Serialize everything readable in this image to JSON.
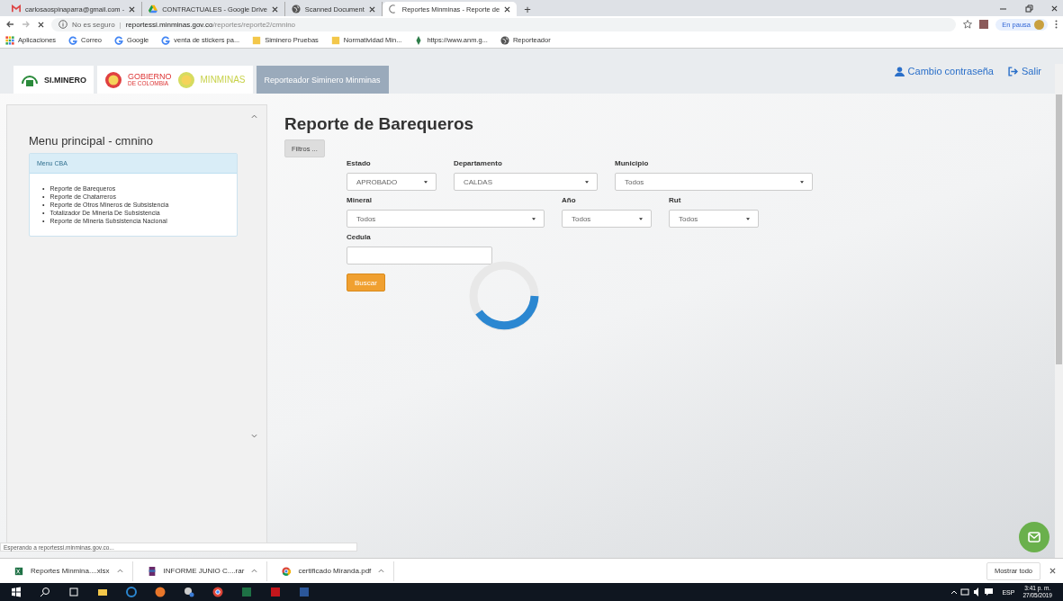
{
  "browser": {
    "tabs": [
      {
        "title": "carlosaospinaparra@gmail.com -",
        "selected": false
      },
      {
        "title": "CONTRACTUALES - Google Drive",
        "selected": false
      },
      {
        "title": "Scanned Document",
        "selected": false
      },
      {
        "title": "Reportes Minminas - Reporte de",
        "selected": true
      }
    ],
    "new_tab": "+",
    "address": {
      "security": "No es seguro",
      "separator": "|",
      "host": "reportessi.minminas.gov.co",
      "path": "/reportes/reporte2/cmnino"
    },
    "profile": {
      "status": "En pausa"
    },
    "bookmarks": [
      {
        "label": "Aplicaciones"
      },
      {
        "label": "Correo"
      },
      {
        "label": "Google"
      },
      {
        "label": "venta de stickers pa..."
      },
      {
        "label": "Siminero Pruebas"
      },
      {
        "label": "Normatividad Min..."
      },
      {
        "label": "https://www.anm.g..."
      },
      {
        "label": "Reporteador"
      }
    ]
  },
  "page": {
    "header": {
      "logo_siminero": "SI.MINERO",
      "logo_gobierno": [
        "GOBIERNO",
        "DE COLOMBIA"
      ],
      "logo_minminas": "MINMINAS",
      "nav_title": "Reporteador Siminero Minminas",
      "user_links": [
        "Cambio contraseña",
        "Salir"
      ]
    },
    "sidebar": {
      "title": "Menu principal - cmnino",
      "menu_heading": "Menu CBA",
      "bullet": "•",
      "items": [
        "Reporte de Barequeros",
        "Reporte de Chatarreros",
        "Reporte de Otros Mineros de Subsistencia",
        "Totalizador De Mineria De Subsistencia",
        "Reporte de Mineria Subsistencia Nacional"
      ]
    },
    "report": {
      "title": "Reporte de Barequeros",
      "filter_toggle": "Filtros ...",
      "rows": [
        [
          {
            "label": "Estado",
            "kind": "select",
            "value": "APROBADO"
          },
          {
            "label": "Departamento",
            "kind": "select",
            "value": "CALDAS"
          },
          {
            "label": "Municipio",
            "kind": "select",
            "value": "Todos"
          }
        ],
        [
          {
            "label": "Mineral",
            "kind": "select",
            "value": "Todos"
          },
          {
            "label": "Año",
            "kind": "select",
            "value": "Todos"
          },
          {
            "label": "Rut",
            "kind": "select",
            "value": "Todos"
          }
        ],
        [
          {
            "label": "Cedula",
            "kind": "text"
          }
        ]
      ],
      "submit": "Buscar"
    },
    "status_text": "Esperando a reportessi.minminas.gov.co..."
  },
  "downloads": {
    "items": [
      {
        "name": "Reportes Minmina....xlsx"
      },
      {
        "name": "INFORME  JUNIO C....rar"
      },
      {
        "name": "certificado Miranda.pdf"
      }
    ],
    "show_all": "Mostrar todo"
  },
  "taskbar": {
    "language": "ESP",
    "time": "3:41 p. m.",
    "date": "27/05/2019"
  }
}
